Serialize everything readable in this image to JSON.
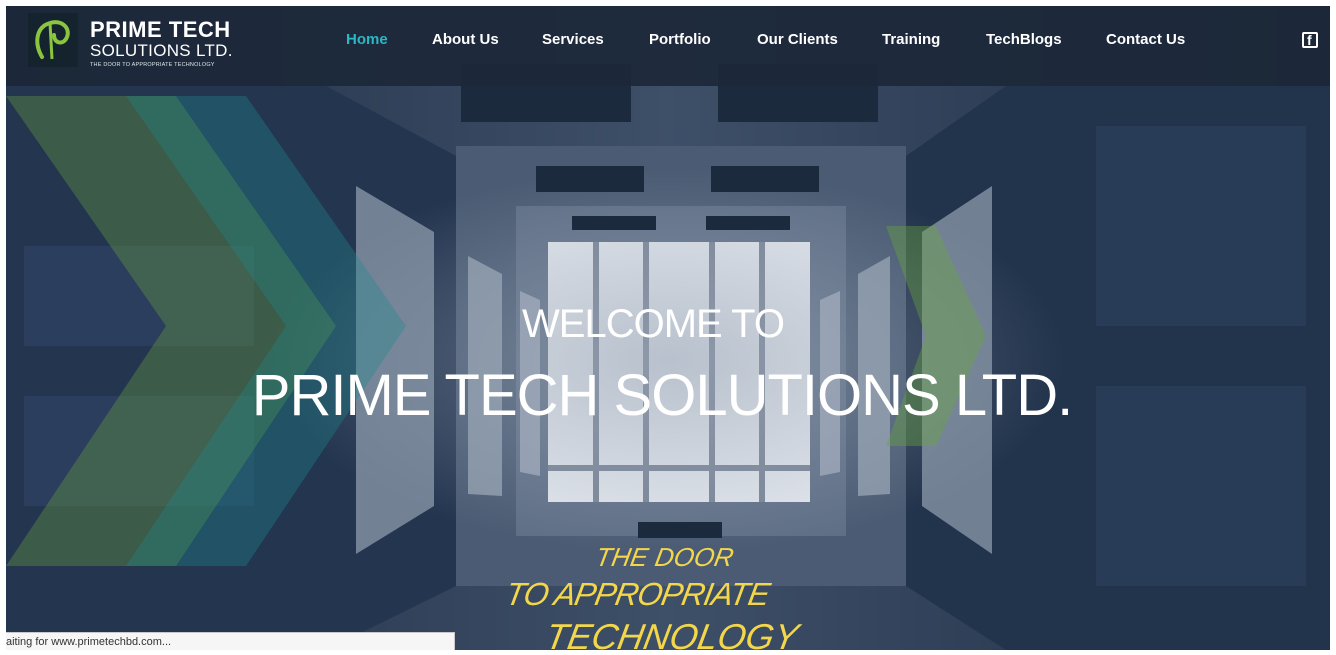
{
  "logo": {
    "line1": "PRIME TECH",
    "line2": "SOLUTIONS LTD.",
    "tagline": "THE DOOR TO APPROPRIATE TECHNOLOGY"
  },
  "nav": [
    {
      "label": "Home",
      "active": true
    },
    {
      "label": "About Us",
      "active": false
    },
    {
      "label": "Services",
      "active": false
    },
    {
      "label": "Portfolio",
      "active": false
    },
    {
      "label": "Our Clients",
      "active": false
    },
    {
      "label": "Training",
      "active": false
    },
    {
      "label": "TechBlogs",
      "active": false
    },
    {
      "label": "Contact Us",
      "active": false
    }
  ],
  "social": {
    "icon": "facebook-icon",
    "glyph": "f"
  },
  "hero": {
    "welcome_line1": "WELCOME TO",
    "welcome_line2": "PRIME TECH SOLUTIONS LTD.",
    "tag_line1": "THE DOOR",
    "tag_line2": "TO APPROPRIATE",
    "tag_line3": "TECHNOLOGY"
  },
  "status_bar": "aiting for www.primetechbd.com...",
  "colors": {
    "accent": "#2bb7c4",
    "nav_bg": "#1c2838",
    "tag_yellow": "#f3d64a",
    "logo_green": "#8bc53f"
  }
}
